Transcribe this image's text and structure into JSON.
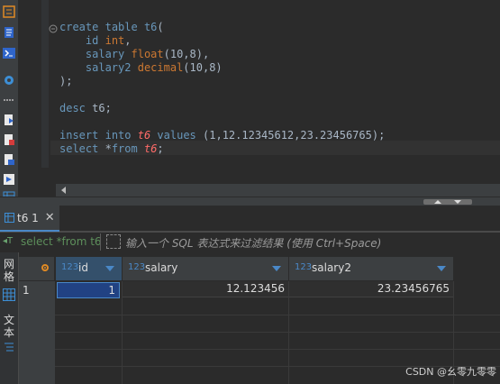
{
  "toolbar": {
    "icons": [
      "database-icon",
      "editor-icon",
      "console-icon",
      "gear-icon",
      "more-icon",
      "file-export-icon",
      "file-delete-icon",
      "file-import-icon",
      "run-icon",
      "table-icon"
    ]
  },
  "editor": {
    "lines": [
      "create table t6(",
      "    id int,",
      "    salary float(10,8),",
      "    salary2 decimal(10,8)",
      ");",
      "",
      "desc t6;",
      "",
      "insert into t6 values (1,12.12345612,23.23456765);",
      "select *from t6;"
    ]
  },
  "result_tab": {
    "label": "t6 1"
  },
  "filter": {
    "query": "select *from t6",
    "placeholder": "输入一个 SQL 表达式来过滤结果 (使用 Ctrl+Space)"
  },
  "side_tabs": {
    "grid_label": "网格",
    "text_label": "文本"
  },
  "grid": {
    "columns": [
      {
        "type": "123",
        "name": "id"
      },
      {
        "type": "123",
        "name": "salary"
      },
      {
        "type": "123",
        "name": "salary2"
      }
    ],
    "rows": [
      {
        "num": "1",
        "cells": [
          "1",
          "12.123456",
          "23.23456765"
        ]
      }
    ]
  },
  "watermark": "CSDN @幺零九零零"
}
